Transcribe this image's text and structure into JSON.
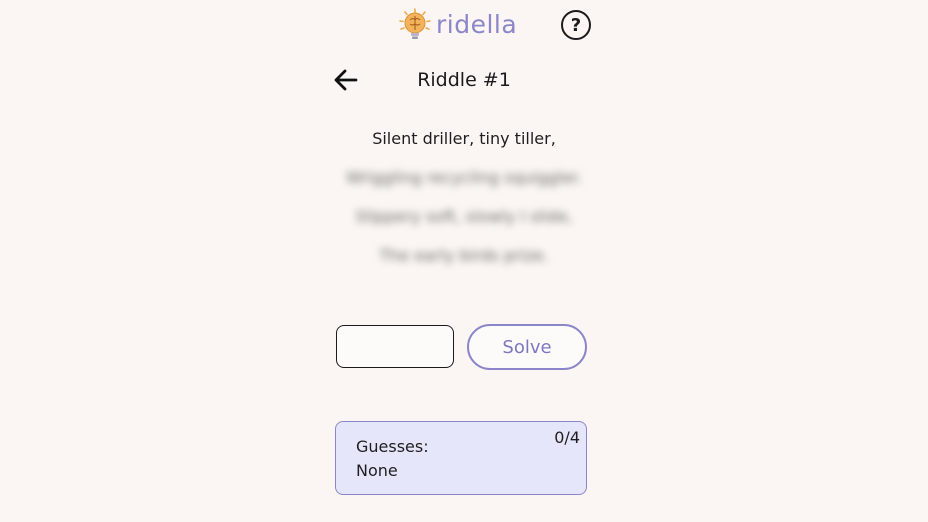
{
  "header": {
    "brand_name": "ridella",
    "help_label": "?"
  },
  "riddle": {
    "title": "Riddle #1",
    "lines": [
      {
        "text": "Silent driller, tiny tiller,",
        "revealed": true
      },
      {
        "text": "Wriggling recycling squiggler.",
        "revealed": false
      },
      {
        "text": "Slippery soft, slowly I slide,",
        "revealed": false
      },
      {
        "text": "The early birds prize.",
        "revealed": false
      }
    ]
  },
  "answer": {
    "value": "",
    "placeholder": "",
    "solve_label": "Solve"
  },
  "guesses": {
    "label": "Guesses:",
    "value": "None",
    "count": "0/4"
  },
  "colors": {
    "accent": "#8a86c9",
    "background": "#fbf6f3",
    "panel": "#e6e6fb",
    "logo": "#f0a94a"
  },
  "icons": {
    "logo": "brain-lightbulb-icon",
    "back": "arrow-left-icon",
    "help": "question-circle-icon"
  }
}
